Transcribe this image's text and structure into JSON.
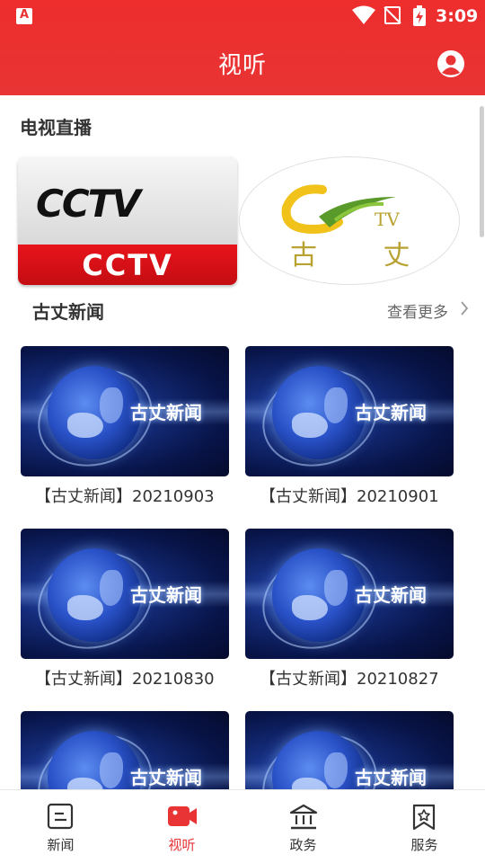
{
  "status_bar": {
    "time": "3:09"
  },
  "header": {
    "title": "视听"
  },
  "live_section": {
    "title": "电视直播",
    "channels": [
      {
        "logo_text": "CCTV",
        "name": "CCTV"
      },
      {
        "logo_text": "TV",
        "name": "古 丈"
      }
    ]
  },
  "news_section": {
    "title": "古丈新闻",
    "more_label": "查看更多",
    "thumbnail_text": "古丈新闻",
    "videos": [
      {
        "title": "【古丈新闻】20210903"
      },
      {
        "title": "【古丈新闻】20210901"
      },
      {
        "title": "【古丈新闻】20210830"
      },
      {
        "title": "【古丈新闻】20210827"
      },
      {
        "title": ""
      },
      {
        "title": ""
      }
    ]
  },
  "tabbar": {
    "items": [
      {
        "label": "新闻",
        "icon": "news-icon",
        "active": false
      },
      {
        "label": "视听",
        "icon": "video-camera-icon",
        "active": true
      },
      {
        "label": "政务",
        "icon": "government-building-icon",
        "active": false
      },
      {
        "label": "服务",
        "icon": "service-bookmark-icon",
        "active": false
      }
    ]
  },
  "colors": {
    "brand_red": "#e83434",
    "tab_inactive": "#333333"
  }
}
